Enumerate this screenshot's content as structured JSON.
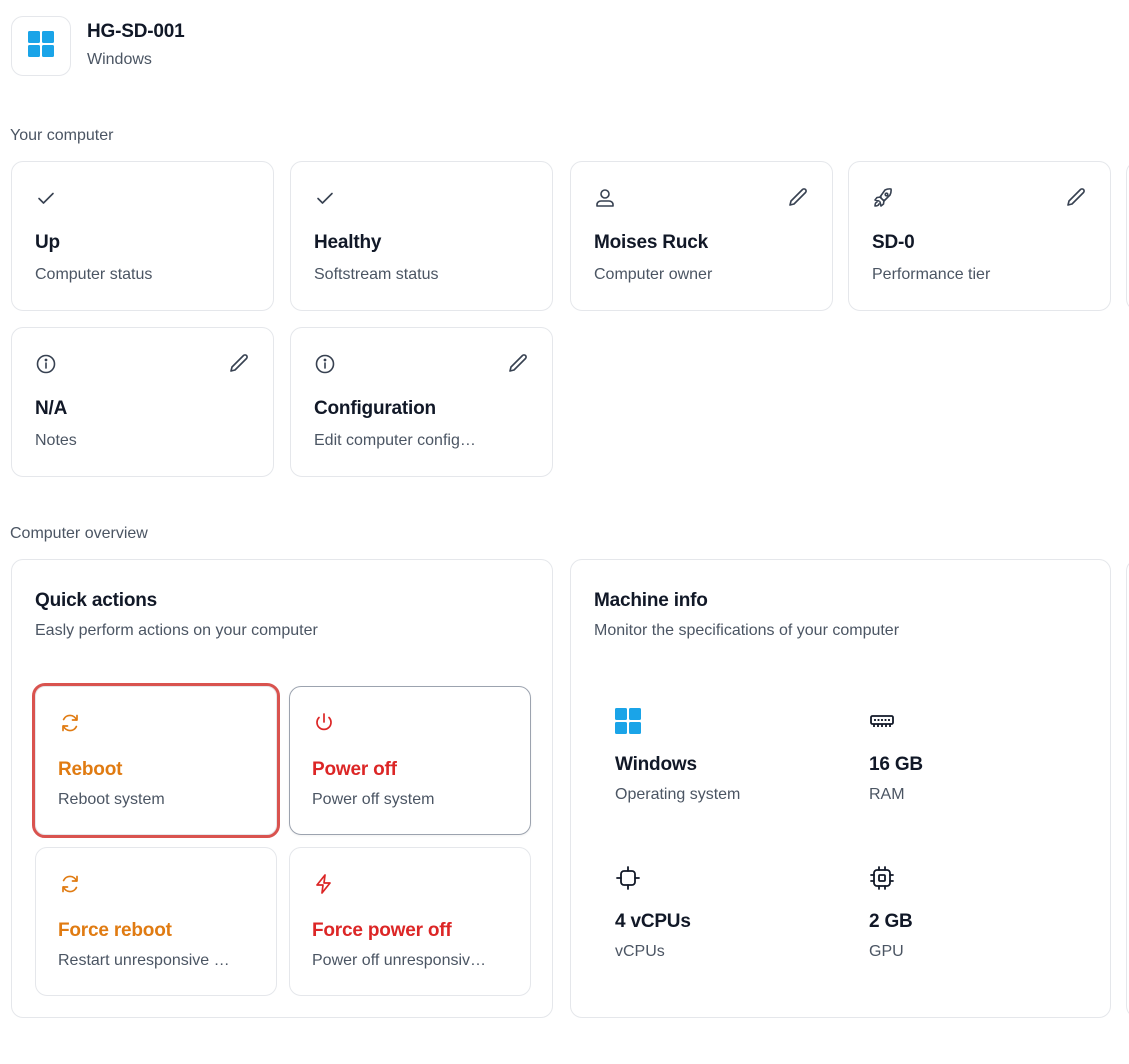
{
  "header": {
    "title": "HG-SD-001",
    "subtitle": "Windows",
    "icon": "windows-logo-icon"
  },
  "sections": {
    "your_computer": "Your computer",
    "overview": "Computer overview"
  },
  "status_cards": [
    {
      "value": "Up",
      "label": "Computer status",
      "icon": "check-icon",
      "editable": false
    },
    {
      "value": "Healthy",
      "label": "Softstream status",
      "icon": "check-icon",
      "editable": false
    },
    {
      "value": "Moises Ruck",
      "label": "Computer owner",
      "icon": "user-icon",
      "editable": true
    },
    {
      "value": "SD-0",
      "label": "Performance tier",
      "icon": "rocket-icon",
      "editable": true
    },
    {
      "value": "N/A",
      "label": "Notes",
      "icon": "info-icon",
      "editable": true
    },
    {
      "value": "Configuration",
      "label": "Edit computer config…",
      "icon": "info-icon",
      "editable": true
    }
  ],
  "quick_actions": {
    "title": "Quick actions",
    "subtitle": "Easly perform actions on your computer",
    "items": [
      {
        "title": "Reboot",
        "subtitle": "Reboot system",
        "icon": "refresh-icon",
        "color": "#e07b12"
      },
      {
        "title": "Power off",
        "subtitle": "Power off system",
        "icon": "power-icon",
        "color": "#dc2626"
      },
      {
        "title": "Force reboot",
        "subtitle": "Restart unresponsive …",
        "icon": "refresh-icon",
        "color": "#e07b12"
      },
      {
        "title": "Force power off",
        "subtitle": "Power off unresponsiv…",
        "icon": "lightning-icon",
        "color": "#dc2626"
      }
    ]
  },
  "machine_info": {
    "title": "Machine info",
    "subtitle": "Monitor the specifications of your computer",
    "specs": [
      {
        "value": "Windows",
        "label": "Operating system",
        "icon": "windows-logo-icon"
      },
      {
        "value": "16 GB",
        "label": "RAM",
        "icon": "memory-icon"
      },
      {
        "value": "4 vCPUs",
        "label": "vCPUs",
        "icon": "cpu-icon"
      },
      {
        "value": "2 GB",
        "label": "GPU",
        "icon": "gpu-icon"
      }
    ]
  },
  "colors": {
    "windows_blue": "#1aa4e8",
    "orange": "#e07b12",
    "red": "#dc2626",
    "selection_outline": "#d9534f"
  }
}
